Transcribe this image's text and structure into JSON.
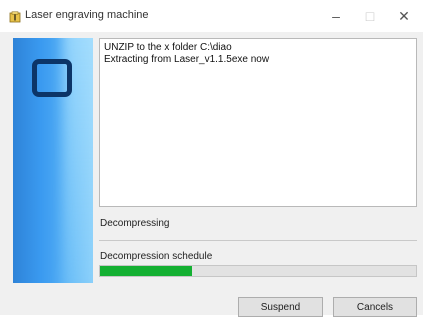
{
  "window": {
    "title": "Laser engraving machine",
    "minimize_symbol": "–",
    "maximize_symbol": "□",
    "close_symbol": "✕"
  },
  "log": {
    "lines": [
      "UNZIP to the x folder C:\\diao",
      "Extracting from Laser_v1.1.5exe now"
    ]
  },
  "status": {
    "label": "Decompressing"
  },
  "progress": {
    "label": "Decompression schedule",
    "fraction": 0.29,
    "color": "#14b032"
  },
  "buttons": {
    "suspend_label": "Suspend",
    "cancel_label": "Cancels"
  },
  "icons": {
    "app": "archive-icon",
    "logo": "rounded-square-logo"
  }
}
